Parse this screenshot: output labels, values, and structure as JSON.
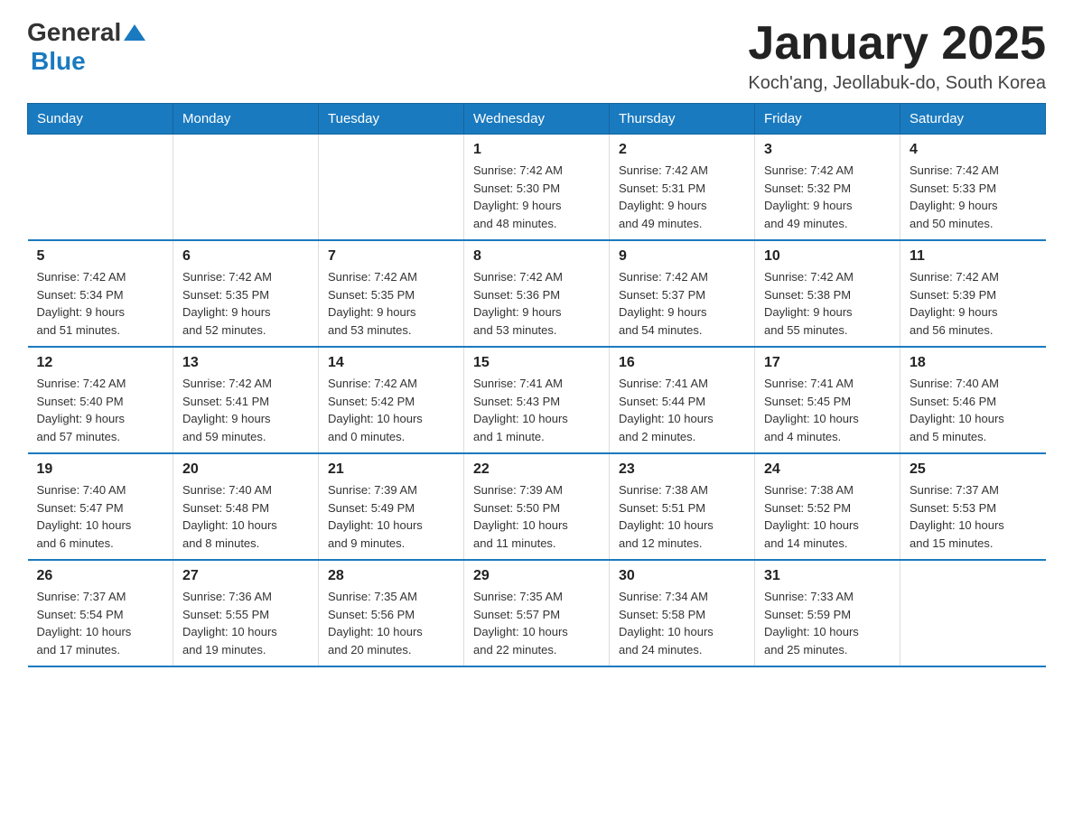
{
  "logo": {
    "general": "General",
    "blue": "Blue"
  },
  "title": "January 2025",
  "subtitle": "Koch'ang, Jeollabuk-do, South Korea",
  "days_of_week": [
    "Sunday",
    "Monday",
    "Tuesday",
    "Wednesday",
    "Thursday",
    "Friday",
    "Saturday"
  ],
  "weeks": [
    [
      {
        "day": "",
        "info": ""
      },
      {
        "day": "",
        "info": ""
      },
      {
        "day": "",
        "info": ""
      },
      {
        "day": "1",
        "info": "Sunrise: 7:42 AM\nSunset: 5:30 PM\nDaylight: 9 hours\nand 48 minutes."
      },
      {
        "day": "2",
        "info": "Sunrise: 7:42 AM\nSunset: 5:31 PM\nDaylight: 9 hours\nand 49 minutes."
      },
      {
        "day": "3",
        "info": "Sunrise: 7:42 AM\nSunset: 5:32 PM\nDaylight: 9 hours\nand 49 minutes."
      },
      {
        "day": "4",
        "info": "Sunrise: 7:42 AM\nSunset: 5:33 PM\nDaylight: 9 hours\nand 50 minutes."
      }
    ],
    [
      {
        "day": "5",
        "info": "Sunrise: 7:42 AM\nSunset: 5:34 PM\nDaylight: 9 hours\nand 51 minutes."
      },
      {
        "day": "6",
        "info": "Sunrise: 7:42 AM\nSunset: 5:35 PM\nDaylight: 9 hours\nand 52 minutes."
      },
      {
        "day": "7",
        "info": "Sunrise: 7:42 AM\nSunset: 5:35 PM\nDaylight: 9 hours\nand 53 minutes."
      },
      {
        "day": "8",
        "info": "Sunrise: 7:42 AM\nSunset: 5:36 PM\nDaylight: 9 hours\nand 53 minutes."
      },
      {
        "day": "9",
        "info": "Sunrise: 7:42 AM\nSunset: 5:37 PM\nDaylight: 9 hours\nand 54 minutes."
      },
      {
        "day": "10",
        "info": "Sunrise: 7:42 AM\nSunset: 5:38 PM\nDaylight: 9 hours\nand 55 minutes."
      },
      {
        "day": "11",
        "info": "Sunrise: 7:42 AM\nSunset: 5:39 PM\nDaylight: 9 hours\nand 56 minutes."
      }
    ],
    [
      {
        "day": "12",
        "info": "Sunrise: 7:42 AM\nSunset: 5:40 PM\nDaylight: 9 hours\nand 57 minutes."
      },
      {
        "day": "13",
        "info": "Sunrise: 7:42 AM\nSunset: 5:41 PM\nDaylight: 9 hours\nand 59 minutes."
      },
      {
        "day": "14",
        "info": "Sunrise: 7:42 AM\nSunset: 5:42 PM\nDaylight: 10 hours\nand 0 minutes."
      },
      {
        "day": "15",
        "info": "Sunrise: 7:41 AM\nSunset: 5:43 PM\nDaylight: 10 hours\nand 1 minute."
      },
      {
        "day": "16",
        "info": "Sunrise: 7:41 AM\nSunset: 5:44 PM\nDaylight: 10 hours\nand 2 minutes."
      },
      {
        "day": "17",
        "info": "Sunrise: 7:41 AM\nSunset: 5:45 PM\nDaylight: 10 hours\nand 4 minutes."
      },
      {
        "day": "18",
        "info": "Sunrise: 7:40 AM\nSunset: 5:46 PM\nDaylight: 10 hours\nand 5 minutes."
      }
    ],
    [
      {
        "day": "19",
        "info": "Sunrise: 7:40 AM\nSunset: 5:47 PM\nDaylight: 10 hours\nand 6 minutes."
      },
      {
        "day": "20",
        "info": "Sunrise: 7:40 AM\nSunset: 5:48 PM\nDaylight: 10 hours\nand 8 minutes."
      },
      {
        "day": "21",
        "info": "Sunrise: 7:39 AM\nSunset: 5:49 PM\nDaylight: 10 hours\nand 9 minutes."
      },
      {
        "day": "22",
        "info": "Sunrise: 7:39 AM\nSunset: 5:50 PM\nDaylight: 10 hours\nand 11 minutes."
      },
      {
        "day": "23",
        "info": "Sunrise: 7:38 AM\nSunset: 5:51 PM\nDaylight: 10 hours\nand 12 minutes."
      },
      {
        "day": "24",
        "info": "Sunrise: 7:38 AM\nSunset: 5:52 PM\nDaylight: 10 hours\nand 14 minutes."
      },
      {
        "day": "25",
        "info": "Sunrise: 7:37 AM\nSunset: 5:53 PM\nDaylight: 10 hours\nand 15 minutes."
      }
    ],
    [
      {
        "day": "26",
        "info": "Sunrise: 7:37 AM\nSunset: 5:54 PM\nDaylight: 10 hours\nand 17 minutes."
      },
      {
        "day": "27",
        "info": "Sunrise: 7:36 AM\nSunset: 5:55 PM\nDaylight: 10 hours\nand 19 minutes."
      },
      {
        "day": "28",
        "info": "Sunrise: 7:35 AM\nSunset: 5:56 PM\nDaylight: 10 hours\nand 20 minutes."
      },
      {
        "day": "29",
        "info": "Sunrise: 7:35 AM\nSunset: 5:57 PM\nDaylight: 10 hours\nand 22 minutes."
      },
      {
        "day": "30",
        "info": "Sunrise: 7:34 AM\nSunset: 5:58 PM\nDaylight: 10 hours\nand 24 minutes."
      },
      {
        "day": "31",
        "info": "Sunrise: 7:33 AM\nSunset: 5:59 PM\nDaylight: 10 hours\nand 25 minutes."
      },
      {
        "day": "",
        "info": ""
      }
    ]
  ]
}
